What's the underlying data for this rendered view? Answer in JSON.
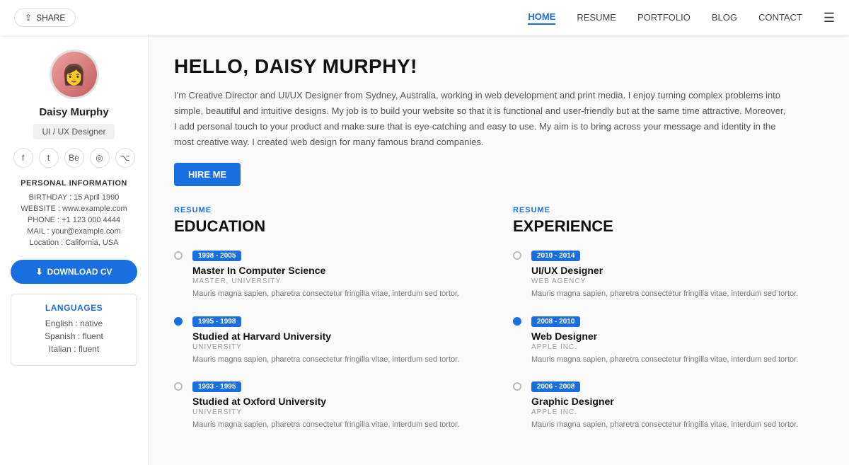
{
  "nav": {
    "share_label": "SHARE",
    "links": [
      {
        "label": "HOME",
        "active": true
      },
      {
        "label": "RESUME",
        "active": false
      },
      {
        "label": "PORTFOLIO",
        "active": false
      },
      {
        "label": "BLOG",
        "active": false
      },
      {
        "label": "CONTACT",
        "active": false
      }
    ]
  },
  "sidebar": {
    "name": "Daisy Murphy",
    "role": "UI / UX Designer",
    "social": [
      "f",
      "t",
      "Be",
      "◎",
      "gh"
    ],
    "personal_info_title": "PERSONAL INFORMATION",
    "birthday": "BIRTHDAY : 15 April 1990",
    "website": "WEBSITE : www.example.com",
    "phone": "PHONE : +1 123 000 4444",
    "mail": "MAIL : your@example.com",
    "location": "Location : California, USA",
    "download_label": "DOWNLOAD CV",
    "languages_title": "LANGUAGES",
    "languages": [
      "English : native",
      "Spanish : fluent",
      "Italian : fluent"
    ]
  },
  "main": {
    "hello_title": "HELLO, DAISY MURPHY!",
    "intro": "I'm Creative Director and UI/UX Designer from Sydney, Australia, working in web development and print media. I enjoy turning complex problems into simple, beautiful and intuitive designs. My job is to build your website so that it is functional and user-friendly but at the same time attractive. Moreover, I add personal touch to your product and make sure that is eye-catching and easy to use. My aim is to bring across your message and identity in the most creative way. I created web design for many famous brand companies.",
    "hire_label": "HIRE ME",
    "education_label": "RESUME",
    "education_title": "EDUCATION",
    "experience_label": "RESUME",
    "experience_title": "EXPERIENCE",
    "education_items": [
      {
        "period": "1998 - 2005",
        "title": "Master In Computer Science",
        "sub": "MASTER, UNIVERSITY",
        "desc": "Mauris magna sapien, pharetra consectetur fringilla vitae, interdum sed tortor.",
        "active": false
      },
      {
        "period": "1995 - 1998",
        "title": "Studied at Harvard University",
        "sub": "UNIVERSITY",
        "desc": "Mauris magna sapien, pharetra consectetur fringilla vitae, interdum sed tortor.",
        "active": true
      },
      {
        "period": "1993 - 1995",
        "title": "Studied at Oxford University",
        "sub": "UNIVERSITY",
        "desc": "Mauris magna sapien, pharetra consectetur fringilla vitae, interdum sed tortor.",
        "active": false
      }
    ],
    "experience_items": [
      {
        "period": "2010 - 2014",
        "title": "UI/UX Designer",
        "sub": "Web Agency",
        "desc": "Mauris magna sapien, pharetra consectetur fringilla vitae, interdum sed tortor.",
        "active": false
      },
      {
        "period": "2008 - 2010",
        "title": "Web Designer",
        "sub": "Apple Inc.",
        "desc": "Mauris magna sapien, pharetra consectetur fringilla vitae, interdum sed tortor.",
        "active": true
      },
      {
        "period": "2006 - 2008",
        "title": "Graphic Designer",
        "sub": "Apple Inc.",
        "desc": "Mauris magna sapien, pharetra consectetur fringilla vitae, interdum sed tortor.",
        "active": false
      }
    ]
  }
}
